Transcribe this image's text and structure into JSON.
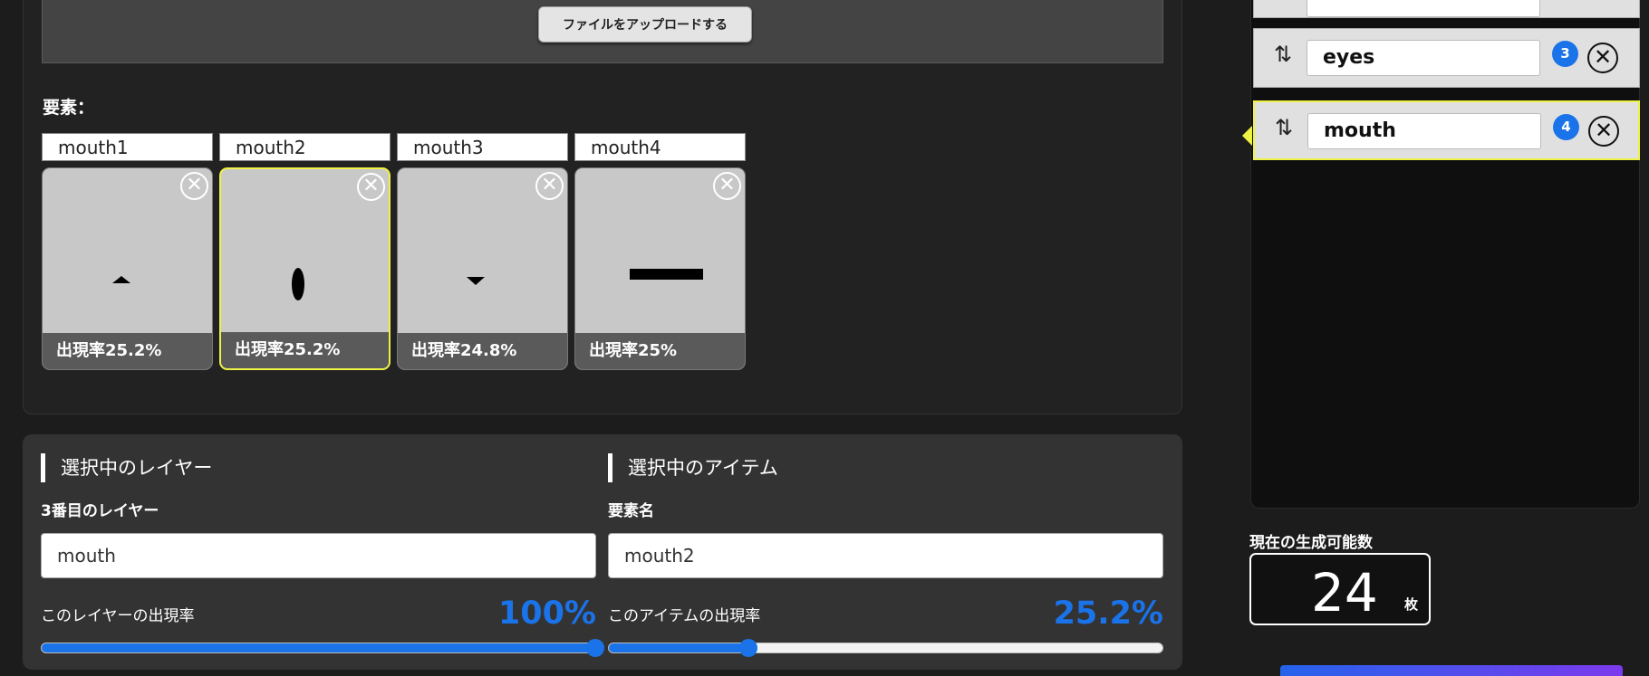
{
  "upload": {
    "button_label": "ファイルをアップロードする"
  },
  "elements": {
    "heading": "要素：",
    "items": [
      {
        "name": "mouth1",
        "rate": "出現率25.2%"
      },
      {
        "name": "mouth2",
        "rate": "出現率25.2%"
      },
      {
        "name": "mouth3",
        "rate": "出現率24.8%"
      },
      {
        "name": "mouth4",
        "rate": "出現率25%"
      }
    ]
  },
  "selected_layer": {
    "title": "選択中のレイヤー",
    "sub_label": "3番目のレイヤー",
    "value": "mouth",
    "rate_label": "このレイヤーの出現率",
    "rate_value": "100%",
    "rate_fraction": 1.0
  },
  "selected_item": {
    "title": "選択中のアイテム",
    "sub_label": "要素名",
    "value": "mouth2",
    "rate_label": "このアイテムの出現率",
    "rate_value": "25.2%",
    "rate_fraction": 0.252
  },
  "layers": [
    {
      "name": "eyes",
      "badge": "3"
    },
    {
      "name": "mouth",
      "badge": "4"
    }
  ],
  "generation": {
    "label": "現在の生成可能数",
    "count": "24",
    "unit": "枚"
  },
  "colors": {
    "accent": "#1a73e8",
    "highlight": "#eef244"
  }
}
